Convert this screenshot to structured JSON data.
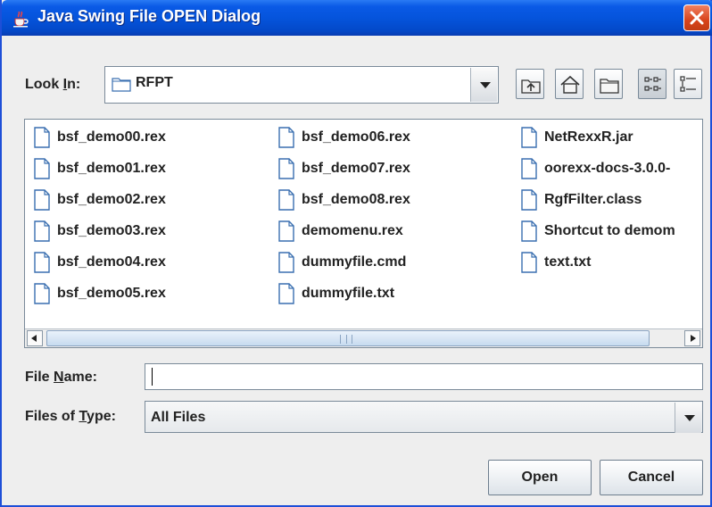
{
  "window": {
    "title": "Java Swing File OPEN Dialog",
    "close_icon": "close-icon",
    "title_icon": "java-cup-icon"
  },
  "look_in": {
    "label_prefix": "Look ",
    "label_mnemonic": "I",
    "label_suffix": "n:",
    "value": "RFPT",
    "icon": "folder-icon"
  },
  "toolbar": {
    "buttons": [
      "up-one-level-icon",
      "home-icon",
      "new-folder-icon",
      "list-view-icon",
      "details-view-icon"
    ]
  },
  "files": {
    "columns": [
      [
        "bsf_demo00.rex",
        "bsf_demo01.rex",
        "bsf_demo02.rex",
        "bsf_demo03.rex",
        "bsf_demo04.rex",
        "bsf_demo05.rex"
      ],
      [
        "bsf_demo06.rex",
        "bsf_demo07.rex",
        "bsf_demo08.rex",
        "demomenu.rex",
        "dummyfile.cmd",
        "dummyfile.txt"
      ],
      [
        "NetRexxR.jar",
        "oorexx-docs-3.0.0-",
        "RgfFilter.class",
        "Shortcut to demom",
        "text.txt"
      ]
    ],
    "icon": "file-icon"
  },
  "file_name": {
    "label_prefix": "File ",
    "label_mnemonic": "N",
    "label_suffix": "ame:",
    "value": "",
    "placeholder": ""
  },
  "file_type": {
    "label_prefix": "Files of ",
    "label_mnemonic": "T",
    "label_suffix": "ype:",
    "value": "All Files"
  },
  "buttons": {
    "open": "Open",
    "cancel": "Cancel"
  },
  "colors": {
    "titlebar": "#0554dc",
    "close": "#d8441c",
    "background": "#eeeeee",
    "file_icon_stroke": "#3a6fb0"
  }
}
